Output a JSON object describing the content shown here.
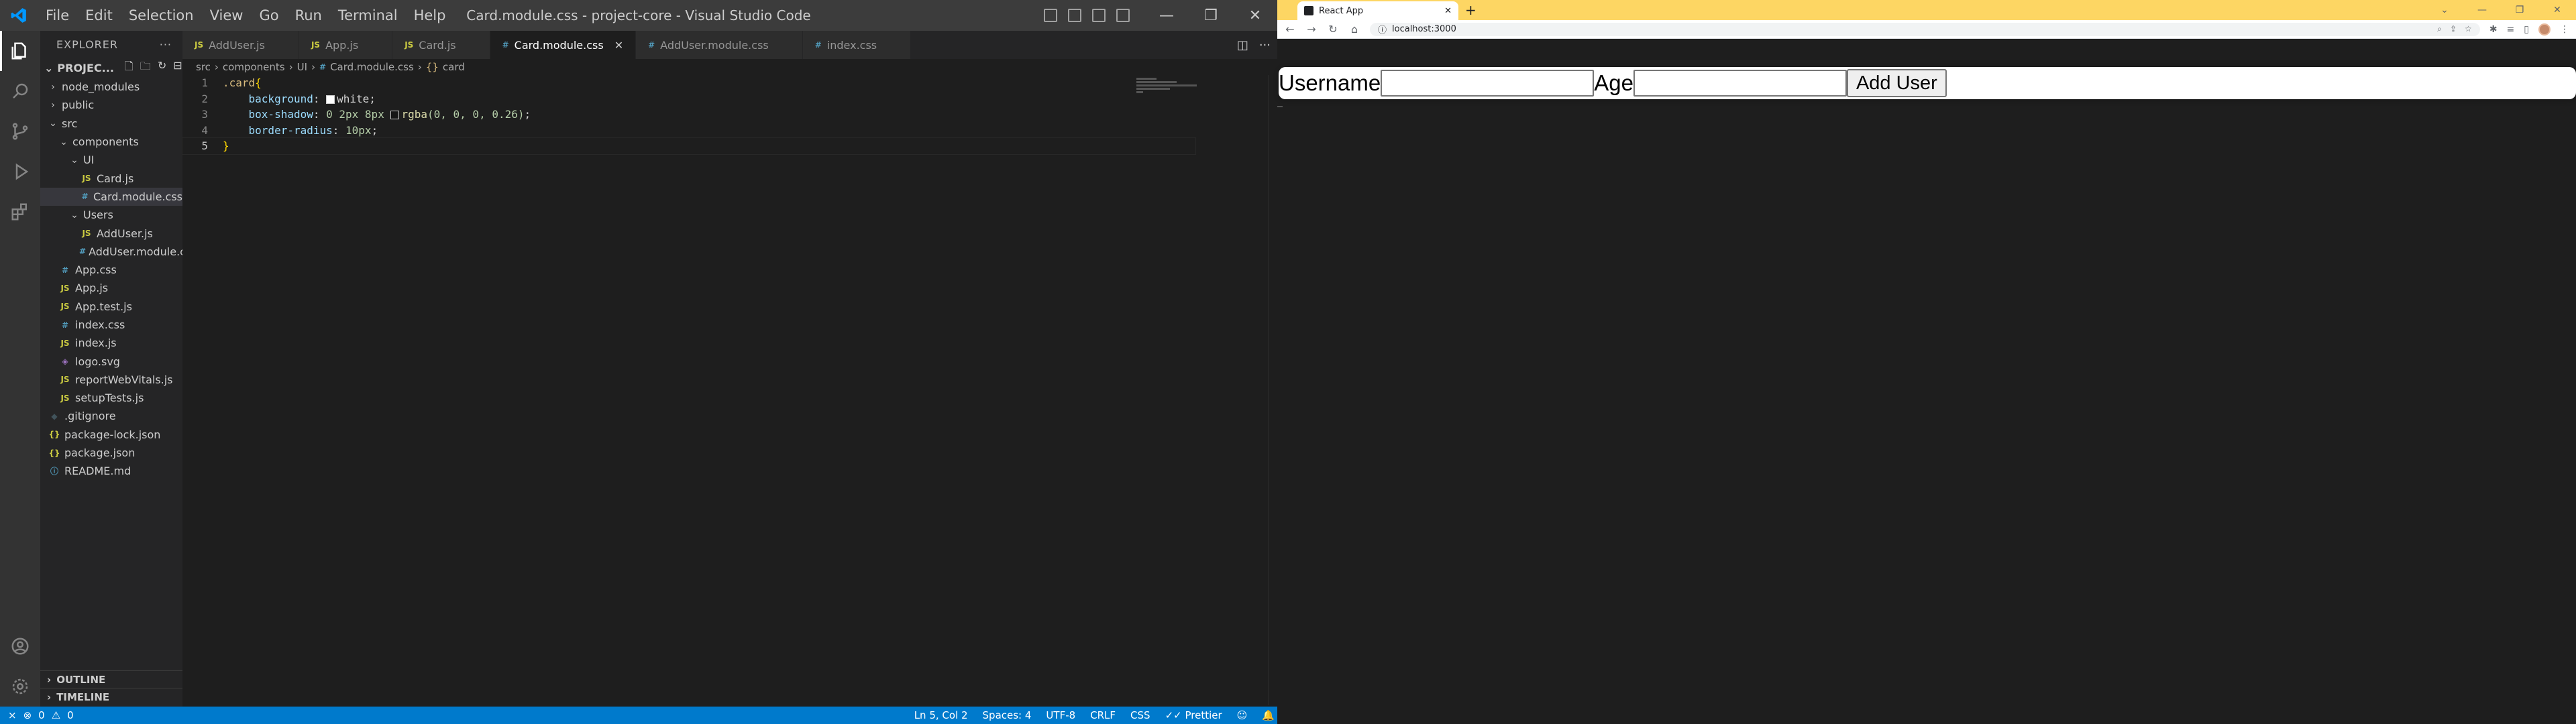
{
  "vscode": {
    "window_title": "Card.module.css - project-core - Visual Studio Code",
    "menu": [
      "File",
      "Edit",
      "Selection",
      "View",
      "Go",
      "Run",
      "Terminal",
      "Help"
    ],
    "explorer": {
      "header": "EXPLORER",
      "project": "PROJEC...",
      "tree": [
        {
          "label": "node_modules",
          "type": "folder",
          "depth": 0,
          "open": false
        },
        {
          "label": "public",
          "type": "folder",
          "depth": 0,
          "open": false
        },
        {
          "label": "src",
          "type": "folder",
          "depth": 0,
          "open": true
        },
        {
          "label": "components",
          "type": "folder",
          "depth": 1,
          "open": true
        },
        {
          "label": "UI",
          "type": "folder",
          "depth": 2,
          "open": true
        },
        {
          "label": "Card.js",
          "type": "js",
          "depth": 3
        },
        {
          "label": "Card.module.css",
          "type": "css",
          "depth": 3,
          "selected": true
        },
        {
          "label": "Users",
          "type": "folder",
          "depth": 2,
          "open": true
        },
        {
          "label": "AddUser.js",
          "type": "js",
          "depth": 3
        },
        {
          "label": "AddUser.module.css",
          "type": "css",
          "depth": 3
        },
        {
          "label": "App.css",
          "type": "css",
          "depth": 1
        },
        {
          "label": "App.js",
          "type": "js",
          "depth": 1
        },
        {
          "label": "App.test.js",
          "type": "js",
          "depth": 1
        },
        {
          "label": "index.css",
          "type": "css",
          "depth": 1
        },
        {
          "label": "index.js",
          "type": "js",
          "depth": 1
        },
        {
          "label": "logo.svg",
          "type": "svg",
          "depth": 1
        },
        {
          "label": "reportWebVitals.js",
          "type": "js",
          "depth": 1
        },
        {
          "label": "setupTests.js",
          "type": "js",
          "depth": 1
        },
        {
          "label": ".gitignore",
          "type": "git",
          "depth": 0
        },
        {
          "label": "package-lock.json",
          "type": "json",
          "depth": 0
        },
        {
          "label": "package.json",
          "type": "json",
          "depth": 0
        },
        {
          "label": "README.md",
          "type": "md",
          "depth": 0
        }
      ],
      "outline": "OUTLINE",
      "timeline": "TIMELINE"
    },
    "tabs": [
      {
        "label": "AddUser.js",
        "type": "js",
        "active": false
      },
      {
        "label": "App.js",
        "type": "js",
        "active": false
      },
      {
        "label": "Card.js",
        "type": "js",
        "active": false
      },
      {
        "label": "Card.module.css",
        "type": "css",
        "active": true
      },
      {
        "label": "AddUser.module.css",
        "type": "css",
        "active": false
      },
      {
        "label": "index.css",
        "type": "css",
        "active": false
      }
    ],
    "breadcrumb": [
      "src",
      "components",
      "UI",
      "Card.module.css",
      "card"
    ],
    "code": {
      "line1_selector": ".card",
      "line1_brace": "{",
      "line2_prop": "background",
      "line2_value": "white",
      "line3_prop": "box-shadow",
      "line3_num": "0 2px 8px",
      "line3_fn": "rgba",
      "line3_args": "(0, 0, 0, 0.26)",
      "line4_prop": "border-radius",
      "line4_value": "10px",
      "line5_brace": "}",
      "line_numbers": [
        "1",
        "2",
        "3",
        "4",
        "5"
      ]
    },
    "status": {
      "errors": "0",
      "warnings": "0",
      "position": "Ln 5, Col 2",
      "spaces": "Spaces: 4",
      "encoding": "UTF-8",
      "eol": "CRLF",
      "language": "CSS",
      "prettier": "Prettier"
    }
  },
  "browser": {
    "tab_title": "React App",
    "url": "localhost:3000",
    "form": {
      "username_label": "Username",
      "age_label": "Age",
      "username_value": "",
      "age_value": "",
      "submit_label": "Add User"
    }
  },
  "colors": {
    "vscode_status": "#007acc",
    "chrome_tabstrip": "#fdd663"
  }
}
